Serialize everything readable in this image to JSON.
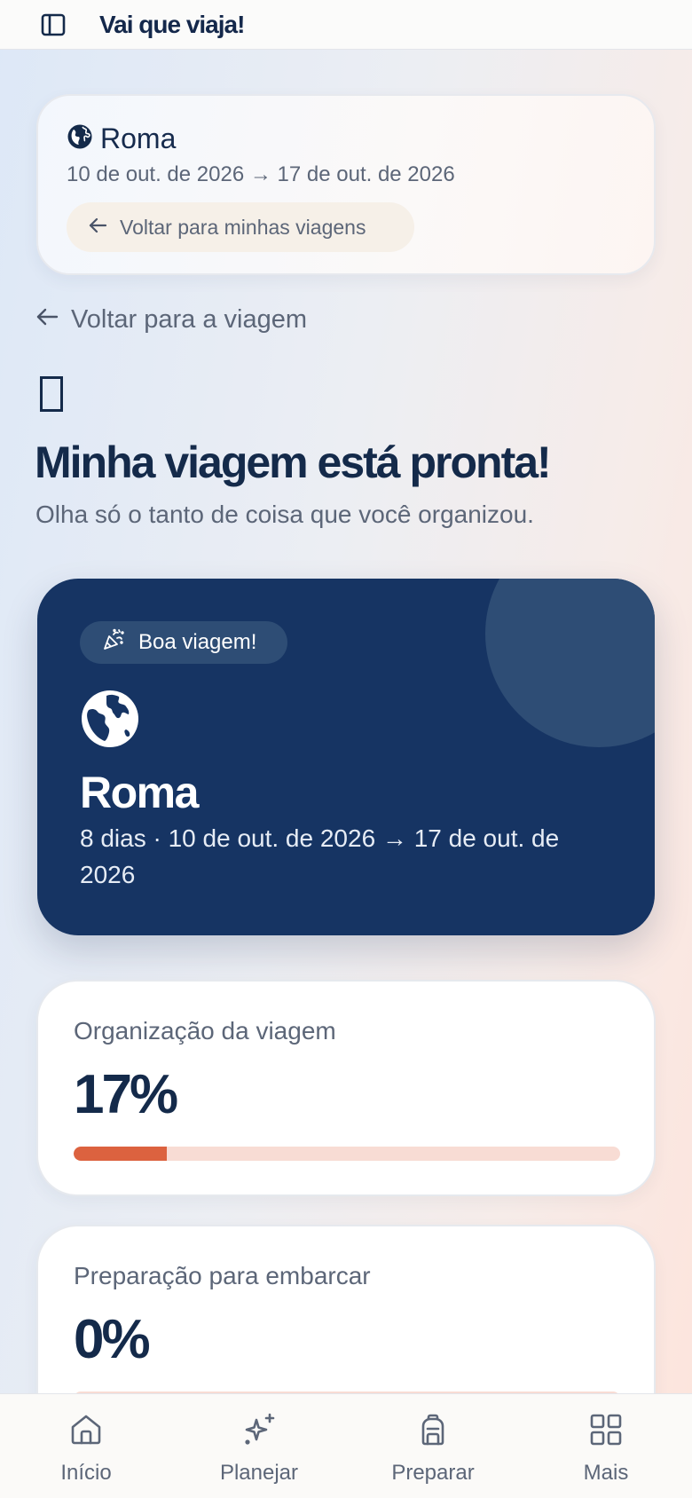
{
  "app": {
    "title": "Vai que viaja!"
  },
  "trip_header": {
    "destination": "Roma",
    "dates": "10 de out. de 2026 → 17 de out. de 2026",
    "back_label": "Voltar para minhas viagens"
  },
  "back_to_trip": "Voltar para a viagem",
  "page": {
    "title": "Minha viagem está pronta!",
    "subtitle": "Olha só o tanto de coisa que você organizou."
  },
  "hero": {
    "badge": "Boa viagem!",
    "destination": "Roma",
    "details": "8 dias · 10 de out. de 2026 → 17 de out. de 2026"
  },
  "progress": [
    {
      "label": "Organização da viagem",
      "value": "17%",
      "fraction": 0.17
    },
    {
      "label": "Preparação para embarcar",
      "value": "0%",
      "fraction": 0
    }
  ],
  "nav": [
    {
      "label": "Início",
      "icon": "home-icon"
    },
    {
      "label": "Planejar",
      "icon": "sparkles-icon"
    },
    {
      "label": "Preparar",
      "icon": "backpack-icon"
    },
    {
      "label": "Mais",
      "icon": "grid-icon"
    }
  ],
  "colors": {
    "navy": "#163463",
    "accent": "#dc623f",
    "progress_track": "#f8dcd4",
    "muted_text": "#5c6678"
  }
}
